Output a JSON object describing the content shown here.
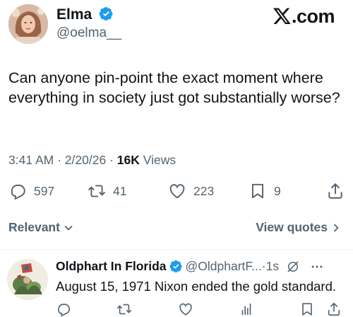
{
  "post": {
    "author_name": "Elma",
    "author_handle": "@oelma__",
    "brand": "X.com",
    "brand_suffix": ".com",
    "text": "Can anyone pin-point the exact moment where everything in society just got substantially worse?",
    "time": "3:41 AM",
    "date": "2/20/26",
    "views_count": "16K",
    "views_label": "Views"
  },
  "actions": {
    "replies": "597",
    "reposts": "41",
    "likes": "223",
    "bookmarks": "9"
  },
  "filter": {
    "sort_label": "Relevant",
    "view_quotes_label": "View quotes"
  },
  "reply": {
    "author_name": "Oldphart In Florida",
    "author_handle": "@OldphartF...",
    "time": "1s",
    "separator": "·",
    "text": "August 15, 1971 Nixon ended the gold standard."
  },
  "colors": {
    "text_primary": "#0f1419",
    "text_secondary": "#536471",
    "verified_blue": "#1d9bf0"
  }
}
